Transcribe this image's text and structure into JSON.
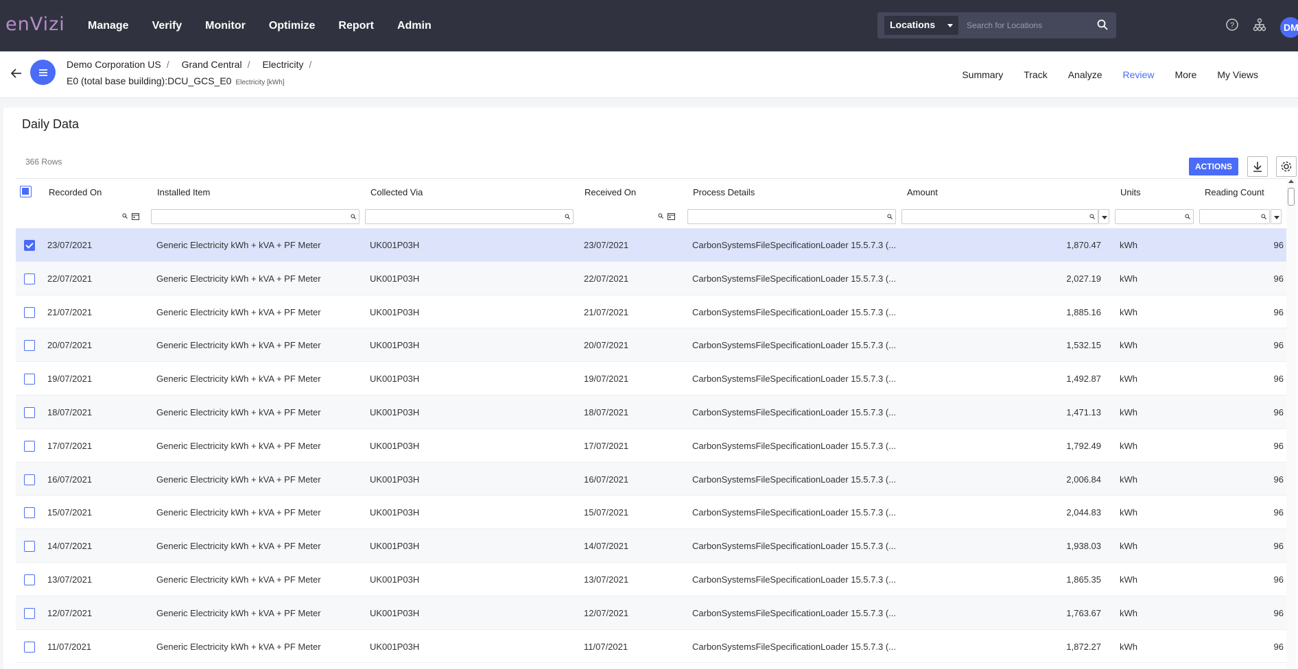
{
  "app": {
    "logo": "enVizi"
  },
  "nav": [
    "Manage",
    "Verify",
    "Monitor",
    "Optimize",
    "Report",
    "Admin"
  ],
  "search": {
    "scope": "Locations",
    "placeholder": "Search for Locations"
  },
  "user": {
    "initials": "DM"
  },
  "breadcrumb": [
    "Demo Corporation US",
    "Grand Central",
    "Electricity"
  ],
  "meter": {
    "name": "E0 (total base building):DCU_GCS_E0",
    "unit": "Electricity [kWh]"
  },
  "view_tabs": [
    {
      "label": "Summary",
      "active": false
    },
    {
      "label": "Track",
      "active": false
    },
    {
      "label": "Analyze",
      "active": false
    },
    {
      "label": "Review",
      "active": true
    },
    {
      "label": "More",
      "active": false
    },
    {
      "label": "My Views",
      "active": false
    }
  ],
  "page": {
    "title": "Daily Data",
    "row_count": "366 Rows",
    "actions_label": "ACTIONS"
  },
  "columns": [
    "Recorded On",
    "Installed Item",
    "Collected Via",
    "Received On",
    "Process Details",
    "Amount",
    "Units",
    "Reading Count"
  ],
  "colors": {
    "accent": "#4a6cf7",
    "topbar": "#30333f",
    "selected_row": "#dce3fb",
    "logo": "#b58cc8"
  },
  "rows": [
    {
      "recorded": "23/07/2021",
      "item": "Generic Electricity kWh + kVA + PF Meter",
      "via": "UK001P03H",
      "received": "23/07/2021",
      "process": "CarbonSystemsFileSpecificationLoader 15.5.7.3 (...",
      "amount": "1,870.47",
      "units": "kWh",
      "count": "96",
      "selected": true
    },
    {
      "recorded": "22/07/2021",
      "item": "Generic Electricity kWh + kVA + PF Meter",
      "via": "UK001P03H",
      "received": "22/07/2021",
      "process": "CarbonSystemsFileSpecificationLoader 15.5.7.3 (...",
      "amount": "2,027.19",
      "units": "kWh",
      "count": "96",
      "selected": false
    },
    {
      "recorded": "21/07/2021",
      "item": "Generic Electricity kWh + kVA + PF Meter",
      "via": "UK001P03H",
      "received": "21/07/2021",
      "process": "CarbonSystemsFileSpecificationLoader 15.5.7.3 (...",
      "amount": "1,885.16",
      "units": "kWh",
      "count": "96",
      "selected": false
    },
    {
      "recorded": "20/07/2021",
      "item": "Generic Electricity kWh + kVA + PF Meter",
      "via": "UK001P03H",
      "received": "20/07/2021",
      "process": "CarbonSystemsFileSpecificationLoader 15.5.7.3 (...",
      "amount": "1,532.15",
      "units": "kWh",
      "count": "96",
      "selected": false
    },
    {
      "recorded": "19/07/2021",
      "item": "Generic Electricity kWh + kVA + PF Meter",
      "via": "UK001P03H",
      "received": "19/07/2021",
      "process": "CarbonSystemsFileSpecificationLoader 15.5.7.3 (...",
      "amount": "1,492.87",
      "units": "kWh",
      "count": "96",
      "selected": false
    },
    {
      "recorded": "18/07/2021",
      "item": "Generic Electricity kWh + kVA + PF Meter",
      "via": "UK001P03H",
      "received": "18/07/2021",
      "process": "CarbonSystemsFileSpecificationLoader 15.5.7.3 (...",
      "amount": "1,471.13",
      "units": "kWh",
      "count": "96",
      "selected": false
    },
    {
      "recorded": "17/07/2021",
      "item": "Generic Electricity kWh + kVA + PF Meter",
      "via": "UK001P03H",
      "received": "17/07/2021",
      "process": "CarbonSystemsFileSpecificationLoader 15.5.7.3 (...",
      "amount": "1,792.49",
      "units": "kWh",
      "count": "96",
      "selected": false
    },
    {
      "recorded": "16/07/2021",
      "item": "Generic Electricity kWh + kVA + PF Meter",
      "via": "UK001P03H",
      "received": "16/07/2021",
      "process": "CarbonSystemsFileSpecificationLoader 15.5.7.3 (...",
      "amount": "2,006.84",
      "units": "kWh",
      "count": "96",
      "selected": false
    },
    {
      "recorded": "15/07/2021",
      "item": "Generic Electricity kWh + kVA + PF Meter",
      "via": "UK001P03H",
      "received": "15/07/2021",
      "process": "CarbonSystemsFileSpecificationLoader 15.5.7.3 (...",
      "amount": "2,044.83",
      "units": "kWh",
      "count": "96",
      "selected": false
    },
    {
      "recorded": "14/07/2021",
      "item": "Generic Electricity kWh + kVA + PF Meter",
      "via": "UK001P03H",
      "received": "14/07/2021",
      "process": "CarbonSystemsFileSpecificationLoader 15.5.7.3 (...",
      "amount": "1,938.03",
      "units": "kWh",
      "count": "96",
      "selected": false
    },
    {
      "recorded": "13/07/2021",
      "item": "Generic Electricity kWh + kVA + PF Meter",
      "via": "UK001P03H",
      "received": "13/07/2021",
      "process": "CarbonSystemsFileSpecificationLoader 15.5.7.3 (...",
      "amount": "1,865.35",
      "units": "kWh",
      "count": "96",
      "selected": false
    },
    {
      "recorded": "12/07/2021",
      "item": "Generic Electricity kWh + kVA + PF Meter",
      "via": "UK001P03H",
      "received": "12/07/2021",
      "process": "CarbonSystemsFileSpecificationLoader 15.5.7.3 (...",
      "amount": "1,763.67",
      "units": "kWh",
      "count": "96",
      "selected": false
    },
    {
      "recorded": "11/07/2021",
      "item": "Generic Electricity kWh + kVA + PF Meter",
      "via": "UK001P03H",
      "received": "11/07/2021",
      "process": "CarbonSystemsFileSpecificationLoader 15.5.7.3 (...",
      "amount": "1,872.27",
      "units": "kWh",
      "count": "96",
      "selected": false
    }
  ]
}
